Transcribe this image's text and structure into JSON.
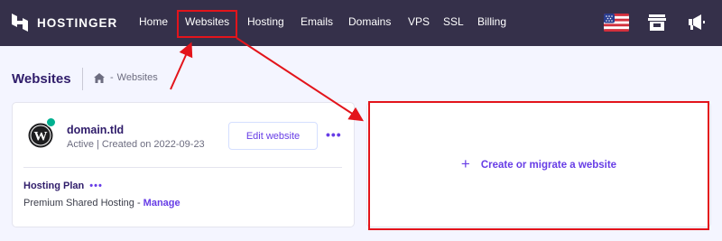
{
  "app": {
    "logo_text": "HOSTINGER",
    "logo_icon": "hostinger-h-icon"
  },
  "nav": {
    "items": [
      {
        "label": "Home"
      },
      {
        "label": "Websites"
      },
      {
        "label": "Hosting"
      },
      {
        "label": "Emails"
      },
      {
        "label": "Domains"
      },
      {
        "label": "VPS"
      },
      {
        "label": "SSL"
      },
      {
        "label": "Billing"
      }
    ],
    "active": "Websites",
    "right_icons": [
      "us-flag-icon",
      "store-icon",
      "megaphone-icon"
    ]
  },
  "page": {
    "title": "Websites",
    "breadcrumb": {
      "home_icon": "home-icon",
      "separator": "-",
      "current": "Websites"
    }
  },
  "website_card": {
    "site_icon": "wordpress-icon",
    "status_color": "#00b090",
    "domain": "domain.tld",
    "meta": "Active | Created on 2022-09-23",
    "edit_label": "Edit website",
    "more_label": "•••",
    "plan_label": "Hosting Plan",
    "plan_more_label": "•••",
    "plan_name": "Premium Shared Hosting",
    "plan_separator": " - ",
    "manage_label": "Manage"
  },
  "create_card": {
    "plus_glyph": "+",
    "label": "Create or migrate a website"
  },
  "colors": {
    "topbar": "#35304a",
    "accent": "#673de6",
    "title": "#2f1c6a",
    "background": "#f4f5ff",
    "annotation": "#e3141b"
  }
}
